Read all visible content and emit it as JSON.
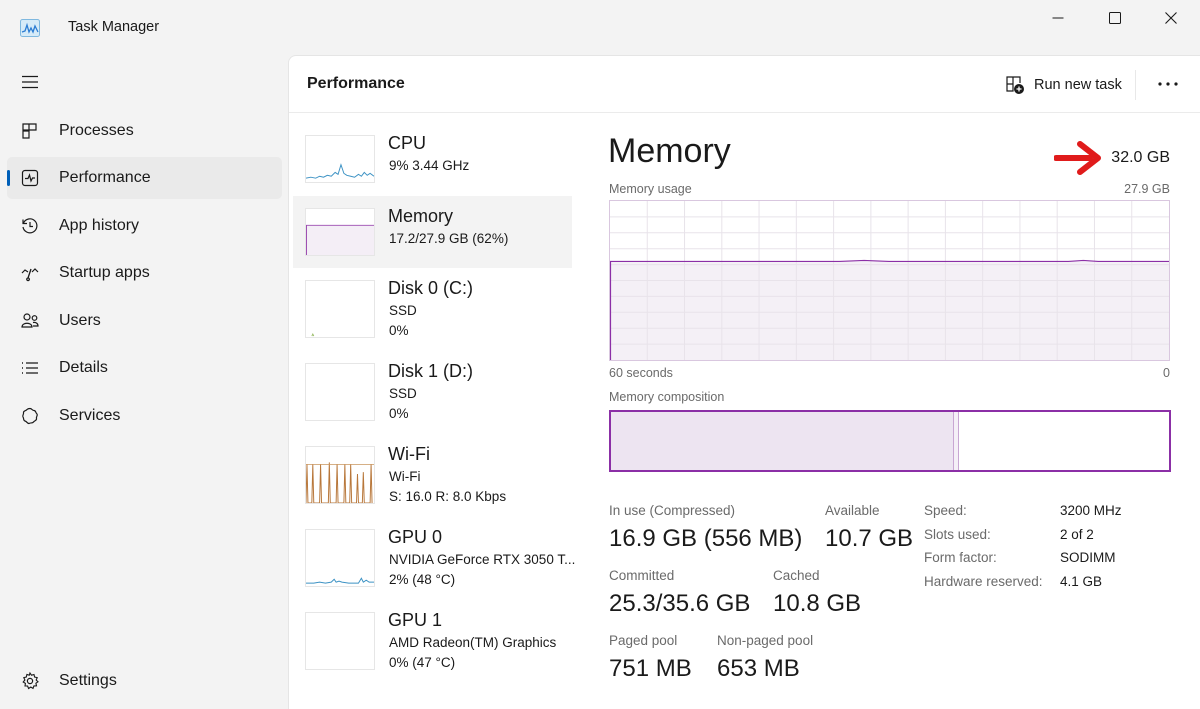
{
  "window": {
    "title": "Task Manager",
    "controls": {
      "minimize": "minimize-icon",
      "maximize": "maximize-icon",
      "close": "close-icon"
    }
  },
  "sidebar": {
    "menu_icon": "hamburger-icon",
    "items": [
      {
        "label": "Processes",
        "icon": "processes-icon",
        "active": false
      },
      {
        "label": "Performance",
        "icon": "performance-icon",
        "active": true
      },
      {
        "label": "App history",
        "icon": "history-icon",
        "active": false
      },
      {
        "label": "Startup apps",
        "icon": "startup-icon",
        "active": false
      },
      {
        "label": "Users",
        "icon": "users-icon",
        "active": false
      },
      {
        "label": "Details",
        "icon": "details-icon",
        "active": false
      },
      {
        "label": "Services",
        "icon": "services-icon",
        "active": false
      }
    ],
    "settings": {
      "label": "Settings",
      "icon": "gear-icon"
    }
  },
  "header": {
    "title": "Performance",
    "run_new_task": "Run new task",
    "more_icon": "more-icon"
  },
  "devices": [
    {
      "name": "CPU",
      "line1": "9%  3.44 GHz",
      "line2": "",
      "active": false,
      "color": "#3c92c4"
    },
    {
      "name": "Memory",
      "line1": "17.2/27.9 GB (62%)",
      "line2": "",
      "active": true,
      "color": "#9b4cb0"
    },
    {
      "name": "Disk 0 (C:)",
      "line1": "SSD",
      "line2": "0%",
      "active": false,
      "color": "#6aa84f"
    },
    {
      "name": "Disk 1 (D:)",
      "line1": "SSD",
      "line2": "0%",
      "active": false,
      "color": "#6aa84f"
    },
    {
      "name": "Wi-Fi",
      "line1": "Wi-Fi",
      "line2": "S: 16.0  R: 8.0 Kbps",
      "active": false,
      "color": "#b8773a"
    },
    {
      "name": "GPU 0",
      "line1": "NVIDIA GeForce RTX 3050 T...",
      "line2": "2%  (48 °C)",
      "active": false,
      "color": "#3c92c4"
    },
    {
      "name": "GPU 1",
      "line1": "AMD Radeon(TM) Graphics",
      "line2": "0%  (47 °C)",
      "active": false,
      "color": "#3c92c4"
    }
  ],
  "detail": {
    "title": "Memory",
    "total": "32.0 GB",
    "usage_label": "Memory usage",
    "usage_max": "27.9 GB",
    "time_left": "60 seconds",
    "time_right": "0",
    "composition_label": "Memory composition",
    "usage_fraction": 0.62,
    "composition": {
      "in_use_fraction": 0.615,
      "modified_fraction": 0.008
    },
    "accent_color": "#8b2fa6",
    "annotation_arrow_color": "#e01b1b",
    "stats": [
      {
        "label": "In use (Compressed)",
        "value": "16.9 GB (556 MB)"
      },
      {
        "label": "Available",
        "value": "10.7 GB"
      },
      {
        "label": "Committed",
        "value": "25.3/35.6 GB"
      },
      {
        "label": "Cached",
        "value": "10.8 GB"
      },
      {
        "label": "Paged pool",
        "value": "751 MB"
      },
      {
        "label": "Non-paged pool",
        "value": "653 MB"
      }
    ],
    "props": [
      {
        "label": "Speed:",
        "value": "3200 MHz"
      },
      {
        "label": "Slots used:",
        "value": "2 of 2"
      },
      {
        "label": "Form factor:",
        "value": "SODIMM"
      },
      {
        "label": "Hardware reserved:",
        "value": "4.1 GB"
      }
    ]
  }
}
